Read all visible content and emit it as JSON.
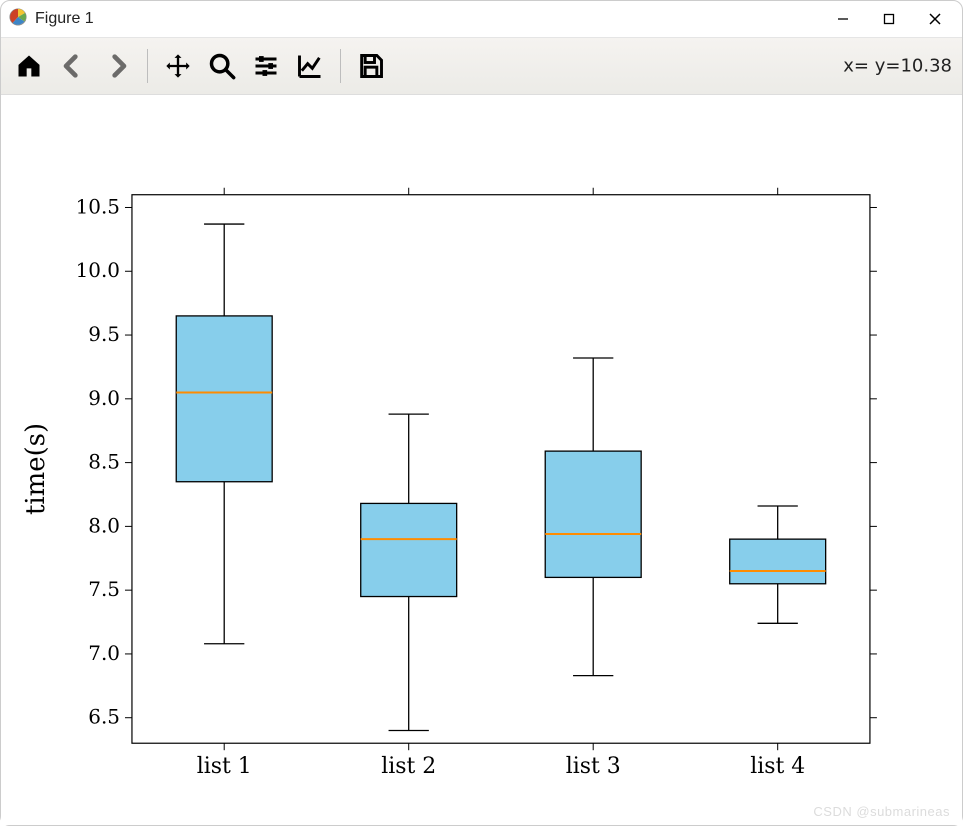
{
  "window": {
    "title": "Figure 1"
  },
  "toolbar": {
    "coord_readout": "x= y=10.38",
    "items": {
      "home": "home-icon",
      "back": "arrow-left-icon",
      "forward": "arrow-right-icon",
      "pan": "move-icon",
      "zoom": "search-icon",
      "configure": "sliders-icon",
      "edit": "line-chart-icon",
      "save": "save-icon"
    }
  },
  "chart_data": {
    "type": "box",
    "ylabel": "time(s)",
    "xlabel": "",
    "ylim": [
      6.3,
      10.6
    ],
    "yticks": [
      6.5,
      7.0,
      7.5,
      8.0,
      8.5,
      9.0,
      9.5,
      10.0,
      10.5
    ],
    "categories": [
      "list 1",
      "list 2",
      "list 3",
      "list 4"
    ],
    "series": [
      {
        "name": "list 1",
        "q1": 8.35,
        "median": 9.05,
        "q3": 9.65,
        "whisker_low": 7.08,
        "whisker_high": 10.37
      },
      {
        "name": "list 2",
        "q1": 7.45,
        "median": 7.9,
        "q3": 8.18,
        "whisker_low": 6.4,
        "whisker_high": 8.88
      },
      {
        "name": "list 3",
        "q1": 7.6,
        "median": 7.94,
        "q3": 8.59,
        "whisker_low": 6.83,
        "whisker_high": 9.32
      },
      {
        "name": "list 4",
        "q1": 7.55,
        "median": 7.65,
        "q3": 7.9,
        "whisker_low": 7.24,
        "whisker_high": 8.16
      }
    ],
    "colors": {
      "box_fill": "#87ceeb",
      "box_edge": "#000000",
      "median": "#ff8c00",
      "whisker": "#000000"
    }
  },
  "watermark": "CSDN @submarineas"
}
